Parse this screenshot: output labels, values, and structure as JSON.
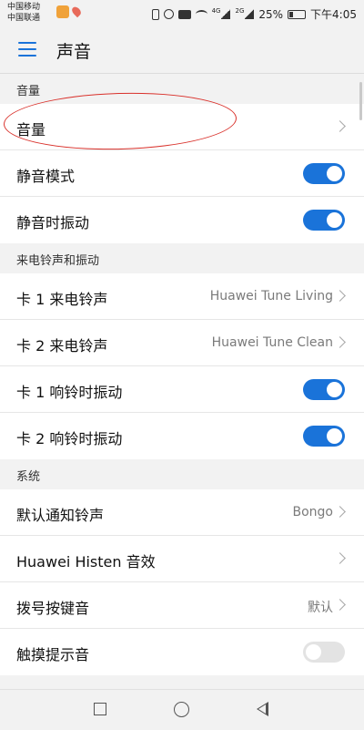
{
  "status_bar": {
    "carrier1": "中国移动",
    "carrier2": "中国联通",
    "network_badge_1": "4G",
    "network_badge_2": "2G",
    "battery": "25%",
    "battery_level": 0.25,
    "time": "下午4:05"
  },
  "app_bar": {
    "title": "声音",
    "menu_icon": "hamburger-icon"
  },
  "sections": {
    "volume": {
      "header": "音量",
      "items": [
        {
          "label": "音量",
          "control": "chevron"
        },
        {
          "label": "静音模式",
          "control": "toggle",
          "checked": true
        },
        {
          "label": "静音时振动",
          "control": "toggle",
          "checked": true
        }
      ]
    },
    "ringtone": {
      "header": "来电铃声和振动",
      "items": [
        {
          "label": "卡 1 来电铃声",
          "value": "Huawei Tune Living",
          "control": "chevron"
        },
        {
          "label": "卡 2 来电铃声",
          "value": "Huawei Tune Clean",
          "control": "chevron"
        },
        {
          "label": "卡 1 响铃时振动",
          "control": "toggle",
          "checked": true
        },
        {
          "label": "卡 2 响铃时振动",
          "control": "toggle",
          "checked": true
        }
      ]
    },
    "system": {
      "header": "系统",
      "items": [
        {
          "label": "默认通知铃声",
          "value": "Bongo",
          "control": "chevron"
        },
        {
          "label": "Huawei Histen 音效",
          "control": "chevron"
        },
        {
          "label": "拨号按键音",
          "value": "默认",
          "control": "chevron"
        },
        {
          "label": "触摸提示音",
          "control": "toggle",
          "checked": false
        }
      ]
    }
  },
  "colors": {
    "accent": "#1a73d9",
    "annotation": "#d9312b",
    "background": "#f2f2f2",
    "toggle_off": "#e3e3e3"
  },
  "nav_bar": {
    "recent": "square-icon",
    "home": "circle-icon",
    "back": "triangle-back-icon"
  }
}
